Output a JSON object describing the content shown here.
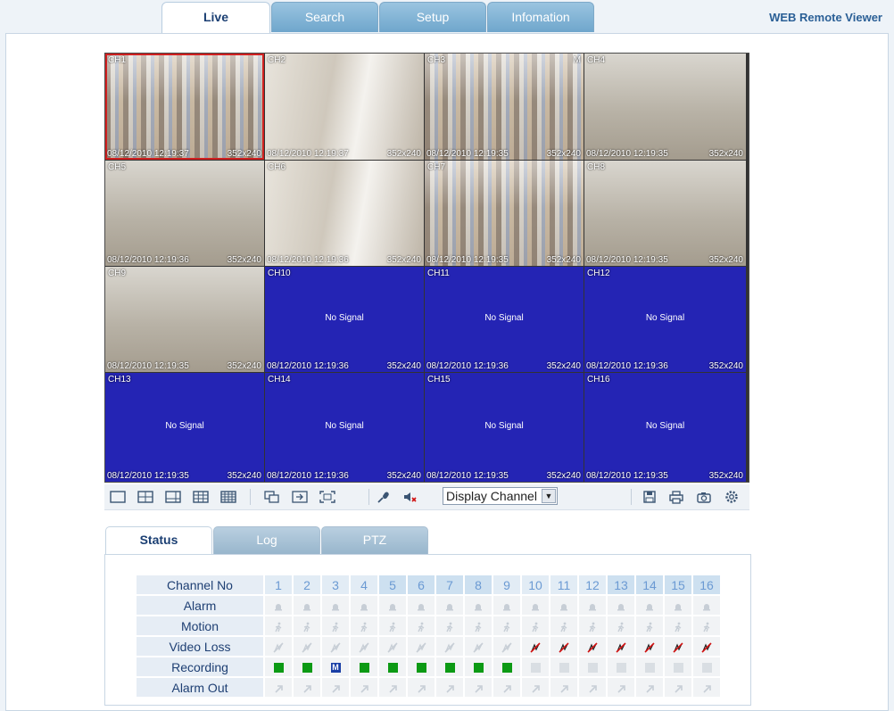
{
  "nav": {
    "tabs": [
      {
        "label": "Live",
        "active": true
      },
      {
        "label": "Search",
        "active": false
      },
      {
        "label": "Setup",
        "active": false
      },
      {
        "label": "Infomation",
        "active": false
      }
    ],
    "brand": "WEB Remote Viewer"
  },
  "channels": [
    {
      "name": "CH1",
      "timestamp": "08/12/2010 12:19:37",
      "resolution": "352x240",
      "signal": true,
      "selected": true
    },
    {
      "name": "CH2",
      "timestamp": "08/12/2010 12:19:37",
      "resolution": "352x240",
      "signal": true
    },
    {
      "name": "CH3",
      "timestamp": "08/12/2010 12:19:35",
      "resolution": "352x240",
      "signal": true,
      "flag": "M"
    },
    {
      "name": "CH4",
      "timestamp": "08/12/2010 12:19:35",
      "resolution": "352x240",
      "signal": true
    },
    {
      "name": "CH5",
      "timestamp": "08/12/2010 12:19:36",
      "resolution": "352x240",
      "signal": true
    },
    {
      "name": "CH6",
      "timestamp": "08/12/2010 12:19:36",
      "resolution": "352x240",
      "signal": true
    },
    {
      "name": "CH7",
      "timestamp": "08/12/2010 12:19:35",
      "resolution": "352x240",
      "signal": true
    },
    {
      "name": "CH8",
      "timestamp": "08/12/2010 12:19:35",
      "resolution": "352x240",
      "signal": true
    },
    {
      "name": "CH9",
      "timestamp": "08/12/2010 12:19:35",
      "resolution": "352x240",
      "signal": true
    },
    {
      "name": "CH10",
      "timestamp": "08/12/2010 12:19:36",
      "resolution": "352x240",
      "signal": false
    },
    {
      "name": "CH11",
      "timestamp": "08/12/2010 12:19:36",
      "resolution": "352x240",
      "signal": false
    },
    {
      "name": "CH12",
      "timestamp": "08/12/2010 12:19:36",
      "resolution": "352x240",
      "signal": false
    },
    {
      "name": "CH13",
      "timestamp": "08/12/2010 12:19:35",
      "resolution": "352x240",
      "signal": false
    },
    {
      "name": "CH14",
      "timestamp": "08/12/2010 12:19:36",
      "resolution": "352x240",
      "signal": false
    },
    {
      "name": "CH15",
      "timestamp": "08/12/2010 12:19:35",
      "resolution": "352x240",
      "signal": false
    },
    {
      "name": "CH16",
      "timestamp": "08/12/2010 12:19:35",
      "resolution": "352x240",
      "signal": false
    }
  ],
  "no_signal_text": "No Signal",
  "toolbar": {
    "display_select": "Display Channel"
  },
  "status": {
    "tabs": [
      {
        "label": "Status",
        "active": true
      },
      {
        "label": "Log",
        "active": false
      },
      {
        "label": "PTZ",
        "active": false
      }
    ],
    "row_labels": {
      "channel": "Channel No",
      "alarm": "Alarm",
      "motion": "Motion",
      "video_loss": "Video Loss",
      "recording": "Recording",
      "alarm_out": "Alarm Out"
    },
    "channel_numbers": [
      "1",
      "2",
      "3",
      "4",
      "5",
      "6",
      "7",
      "8",
      "9",
      "10",
      "11",
      "12",
      "13",
      "14",
      "15",
      "16"
    ],
    "video_loss": [
      false,
      false,
      false,
      false,
      false,
      false,
      false,
      false,
      false,
      true,
      true,
      true,
      true,
      true,
      true,
      true
    ],
    "recording": [
      "on",
      "on",
      "motion",
      "on",
      "on",
      "on",
      "on",
      "on",
      "on",
      "off",
      "off",
      "off",
      "off",
      "off",
      "off",
      "off"
    ],
    "recording_motion_glyph": "M"
  },
  "colors": {
    "no_signal_bg": "#2424b4",
    "recording_on": "#0c9a14",
    "recording_motion": "#1a3fa6",
    "video_loss": "#d01010",
    "selected_outline": "#d02020"
  }
}
